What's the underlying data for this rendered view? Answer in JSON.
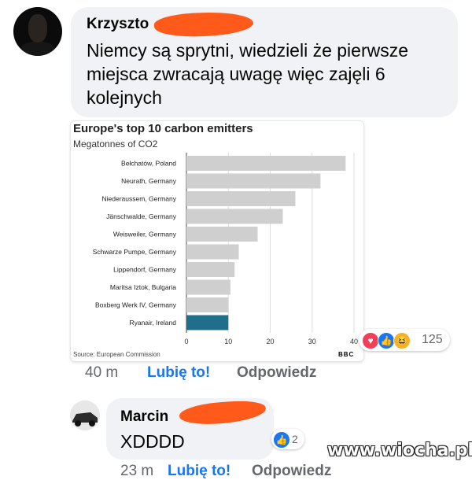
{
  "comment1": {
    "author": "Krzyszto",
    "text": "Niemcy są sprytni, wiedzieli że pierwsze miejsca zwracają uwagę więc zajęli 6 kolejnych",
    "time": "40 m",
    "like_label": "Lubię to!",
    "reply_label": "Odpowiedz",
    "reaction_count": "125",
    "reactions": [
      "love",
      "like",
      "haha"
    ]
  },
  "chart_data": {
    "type": "bar",
    "orientation": "horizontal",
    "title": "Europe's top 10 carbon emitters",
    "subtitle": "Megatonnes of CO2",
    "categories": [
      "Bełchatów, Poland",
      "Neurath, Germany",
      "Niederaussem, Germany",
      "Jänschwalde, Germany",
      "Weisweiler, Germany",
      "Schwarze Pumpe, Germany",
      "Lippendorf, Germany",
      "Maritsa Iztok, Bulgaria",
      "Boxberg Werk IV, Germany",
      "Ryanair, Ireland"
    ],
    "values": [
      38,
      32,
      26,
      23,
      17,
      12.5,
      11.5,
      10.5,
      10,
      10
    ],
    "xlim": [
      0,
      40
    ],
    "xticks": [
      "0",
      "10",
      "20",
      "30",
      "40"
    ],
    "source": "Source: European Commission",
    "bbc": "BBC",
    "colors": {
      "default": "#cfcfcf",
      "highlight": "#1f6e8c"
    },
    "highlight_index": 9,
    "grid": true
  },
  "comment2": {
    "author": "Marcin",
    "text": "XDDDD",
    "reaction_count": "2",
    "time": "23 m",
    "like_label": "Lubię to!",
    "reply_label": "Odpowiedz"
  },
  "watermark": "www.wiocha.pl",
  "colors": {
    "bubble": "#f0f2f5",
    "link": "#1877f2",
    "meta": "#65676b",
    "redaction": "#ff5a1a"
  }
}
